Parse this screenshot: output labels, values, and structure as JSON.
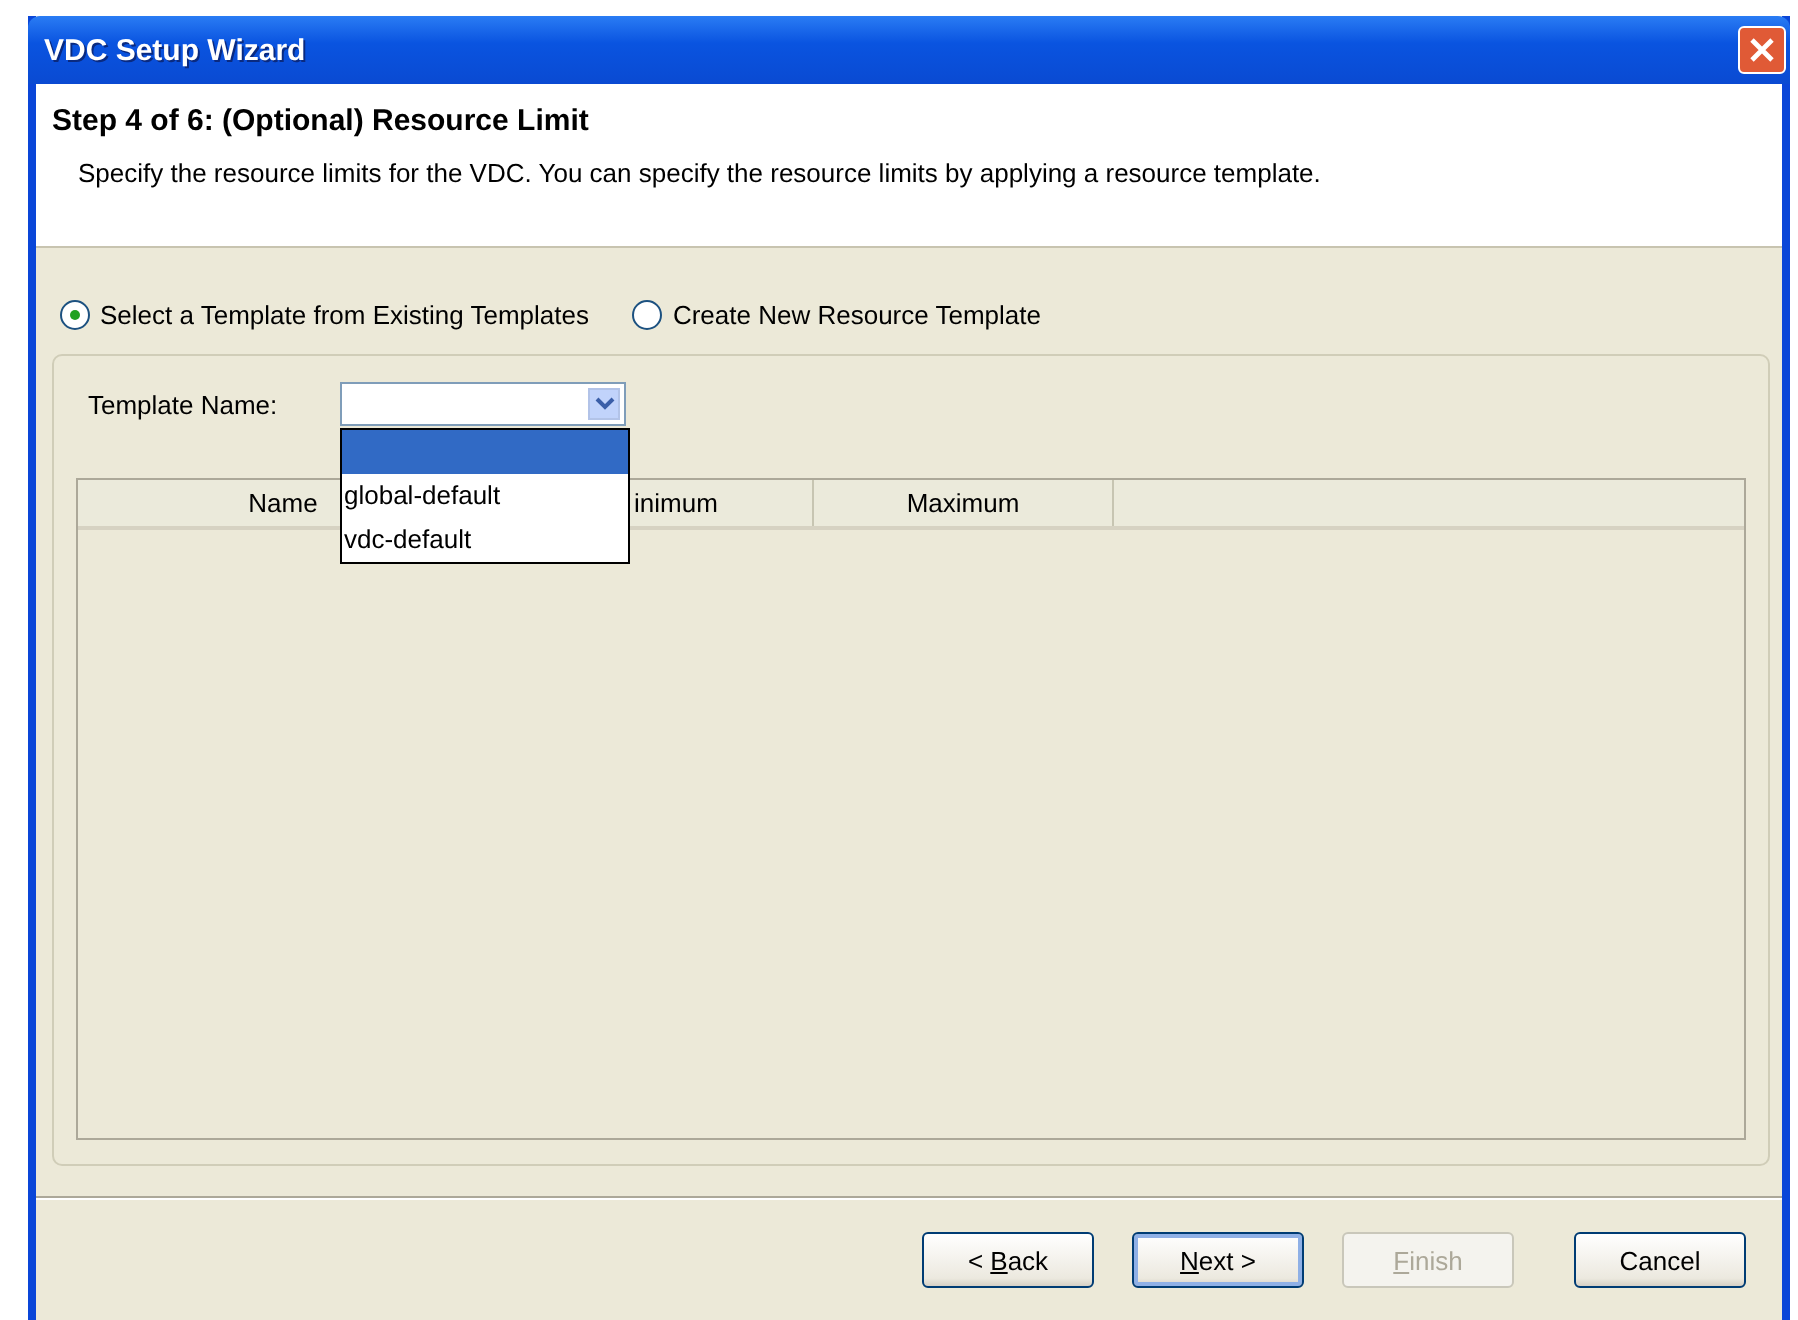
{
  "window": {
    "title": "VDC Setup Wizard"
  },
  "header": {
    "step_title": "Step 4 of 6: (Optional) Resource Limit",
    "description": "Specify the resource limits for the VDC. You can specify the resource limits by applying a resource template."
  },
  "radios": [
    {
      "label": "Select a Template from Existing Templates",
      "selected": true
    },
    {
      "label": "Create New Resource Template",
      "selected": false
    }
  ],
  "template_name": {
    "label": "Template Name:",
    "expanded": true,
    "options": [
      {
        "selected": true
      },
      {
        "label": "global-default",
        "selected": false
      },
      {
        "label": "vdc-default",
        "selected": false
      }
    ]
  },
  "table": {
    "columns": [
      "Name",
      "inimum",
      "Maximum"
    ]
  },
  "buttons": [
    {
      "before": "< ",
      "key": "B",
      "after": "ack",
      "disabled": false,
      "default": false
    },
    {
      "key": "N",
      "after": "ext >",
      "disabled": false,
      "default": true
    },
    {
      "key": "F",
      "after": "inish",
      "disabled": true,
      "default": false
    },
    {
      "before": "Cancel",
      "disabled": false,
      "default": false
    }
  ]
}
